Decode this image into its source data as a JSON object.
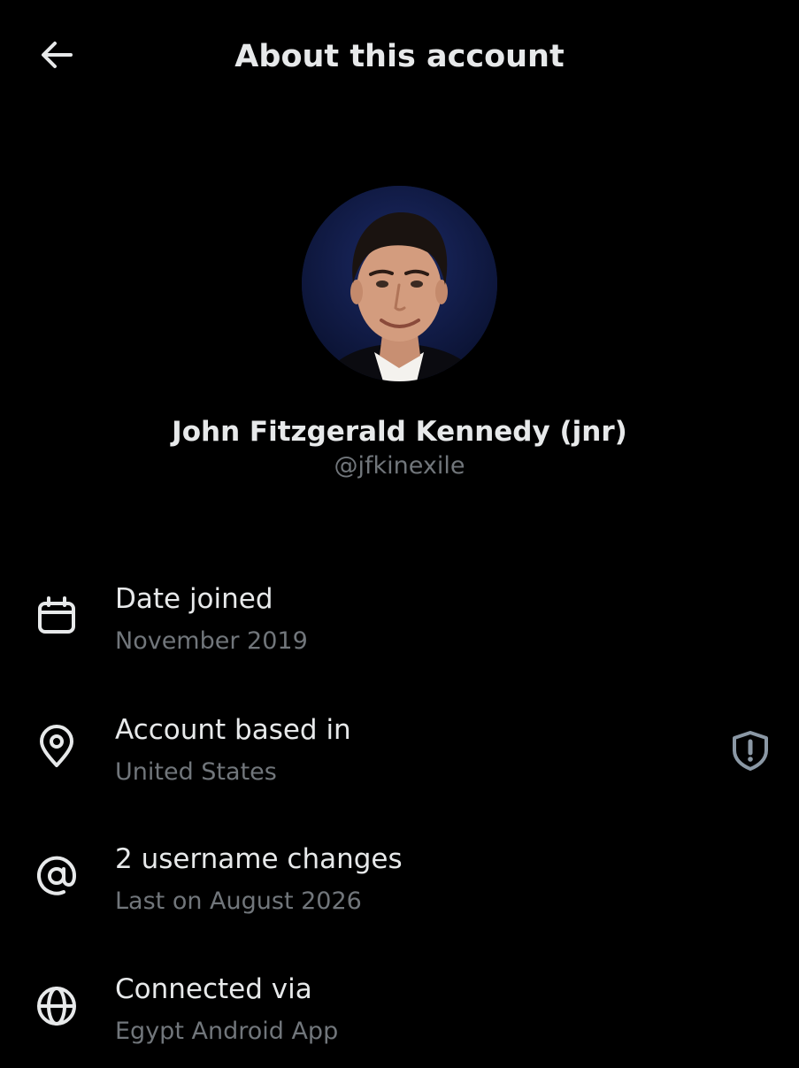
{
  "header": {
    "title": "About this account",
    "back_icon": "arrow-left-icon"
  },
  "profile": {
    "display_name": "John Fitzgerald Kennedy (jnr)",
    "handle": "@jfkinexile",
    "avatar_icon": "profile-photo"
  },
  "details": [
    {
      "icon": "calendar-icon",
      "label": "Date joined",
      "value": "November 2019"
    },
    {
      "icon": "location-pin-icon",
      "label": "Account based in",
      "value": "United States",
      "badge_icon": "shield-alert-icon"
    },
    {
      "icon": "at-sign-icon",
      "label": "2 username changes",
      "value": "Last on August 2026"
    },
    {
      "icon": "globe-icon",
      "label": "Connected via",
      "value": "Egypt Android App"
    }
  ],
  "colors": {
    "background": "#000000",
    "primary_text": "#e7e9ea",
    "secondary_text": "#71767b"
  }
}
